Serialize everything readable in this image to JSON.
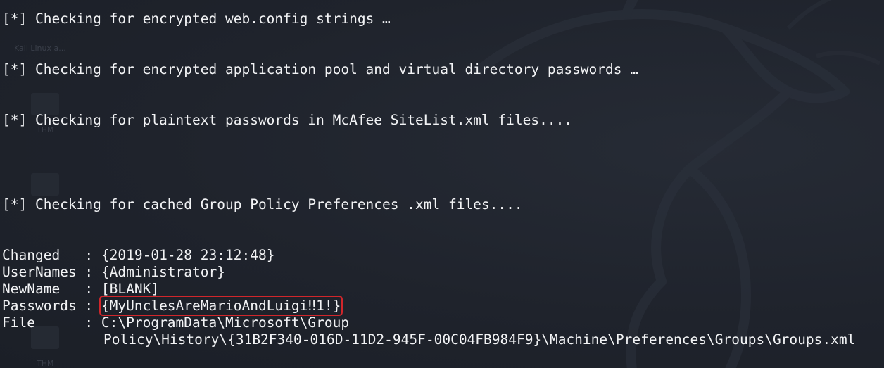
{
  "desktop": {
    "ghost_label_1": "Kali Linux a...",
    "ghost_label_2": "THM",
    "ghost_label_3": "THM"
  },
  "terminal": {
    "checks": [
      "[*] Checking for encrypted web.config strings …",
      "[*] Checking for encrypted application pool and virtual directory passwords …",
      "[*] Checking for plaintext passwords in McAfee SiteList.xml files....",
      "[*] Checking for cached Group Policy Preferences .xml files...."
    ],
    "result": {
      "changed_key": "Changed   : ",
      "changed_val": "{2019-01-28 23:12:48}",
      "usernames_key": "UserNames : ",
      "usernames_val": "{Administrator}",
      "newname_key": "NewName   : ",
      "newname_val": "[BLANK]",
      "passwords_key": "Passwords : ",
      "passwords_val": "{MyUnclesAreMarioAndLuigi‼1!}",
      "file_key": "File      : ",
      "file_val_1": "C:\\ProgramData\\Microsoft\\Group",
      "file_val_2": "Policy\\History\\{31B2F340-016D-11D2-945F-00C04FB984F9}\\Machine\\Preferences\\Groups\\Groups.xml"
    }
  }
}
